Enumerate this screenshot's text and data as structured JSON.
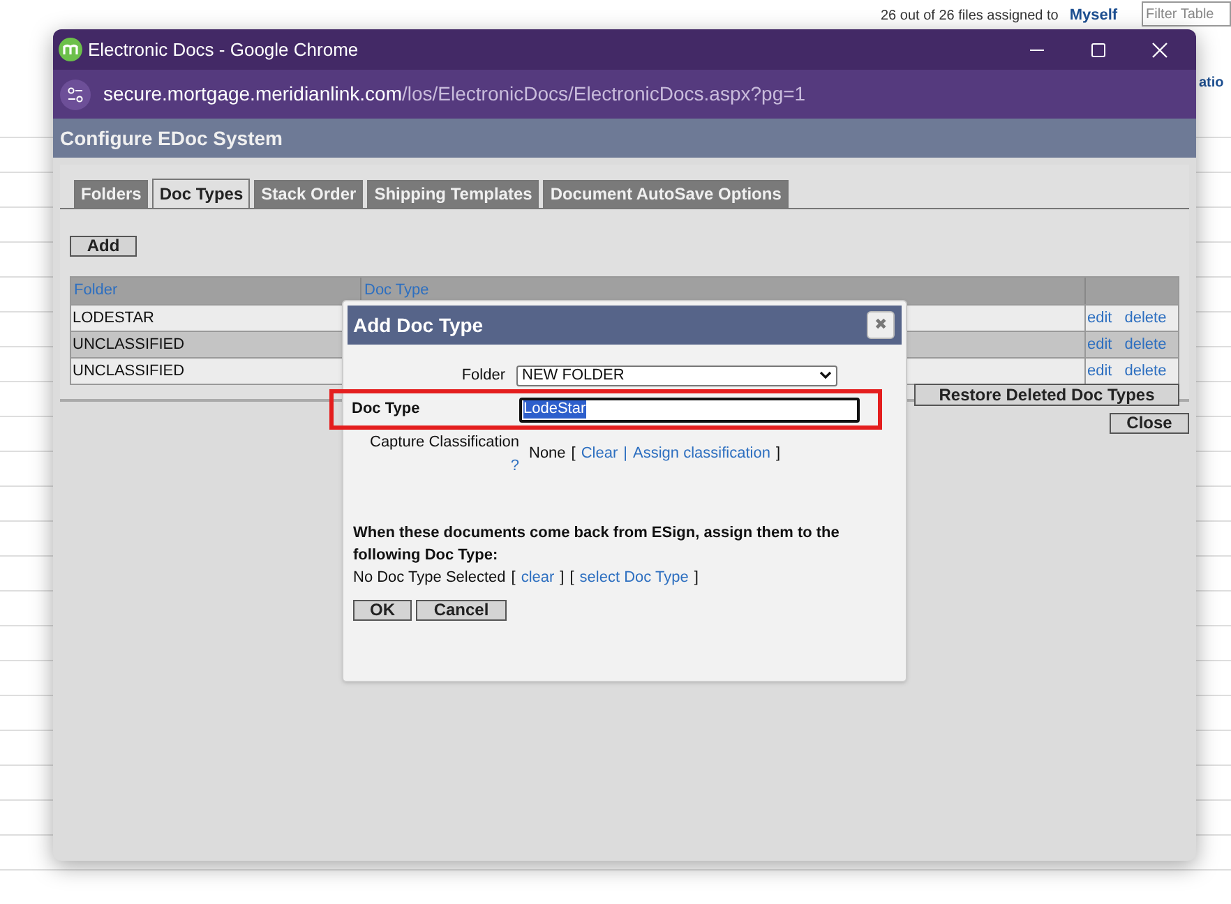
{
  "background_page": {
    "assignment_note": "26 out of 26 files assigned to",
    "assignee_link": "Myself",
    "filter_placeholder": "Filter Table",
    "cut_link": "atio"
  },
  "window": {
    "title": "Electronic Docs - Google Chrome",
    "url_host": "secure.mortgage.meridianlink.com",
    "url_path": "/los/ElectronicDocs/ElectronicDocs.aspx?pg=1"
  },
  "page": {
    "heading": "Configure EDoc System",
    "tabs": [
      {
        "label": "Folders",
        "selected": false
      },
      {
        "label": "Doc Types",
        "selected": true
      },
      {
        "label": "Stack Order",
        "selected": false
      },
      {
        "label": "Shipping Templates",
        "selected": false
      },
      {
        "label": "Document AutoSave Options",
        "selected": false
      }
    ],
    "add_button": "Add",
    "table": {
      "columns": [
        "Folder",
        "Doc Type"
      ],
      "rows": [
        {
          "folder": "LODESTAR",
          "actions": [
            "edit",
            "delete"
          ]
        },
        {
          "folder": "UNCLASSIFIED",
          "actions": [
            "edit",
            "delete"
          ]
        },
        {
          "folder": "UNCLASSIFIED",
          "actions": [
            "edit",
            "delete"
          ]
        }
      ]
    },
    "restore_button": "Restore Deleted Doc Types",
    "close_button": "Close"
  },
  "dialog": {
    "title": "Add Doc Type",
    "close_icon": "✖",
    "folder_label": "Folder",
    "folder_value": "NEW FOLDER",
    "doc_type_label": "Doc Type",
    "doc_type_value": "LodeStar",
    "highlighted": true,
    "capture_label": "Capture Classification",
    "help_mark": "?",
    "capture_parts": [
      {
        "kind": "plain",
        "text": "None"
      },
      {
        "kind": "plain",
        "text": "["
      },
      {
        "kind": "link",
        "text": "Clear"
      },
      {
        "kind": "separator",
        "text": "|"
      },
      {
        "kind": "link",
        "text": "Assign classification"
      },
      {
        "kind": "plain",
        "text": "]"
      }
    ],
    "esign_note": "When these documents come back from ESign, assign them to the following Doc Type:",
    "esign_parts": [
      {
        "kind": "plain",
        "text": "No Doc Type Selected"
      },
      {
        "kind": "plain",
        "text": "["
      },
      {
        "kind": "link",
        "text": "clear"
      },
      {
        "kind": "plain",
        "text": "]"
      },
      {
        "kind": "plain",
        "text": "["
      },
      {
        "kind": "link",
        "text": "select Doc Type"
      },
      {
        "kind": "plain",
        "text": "]"
      }
    ],
    "buttons": [
      "OK",
      "Cancel"
    ]
  }
}
